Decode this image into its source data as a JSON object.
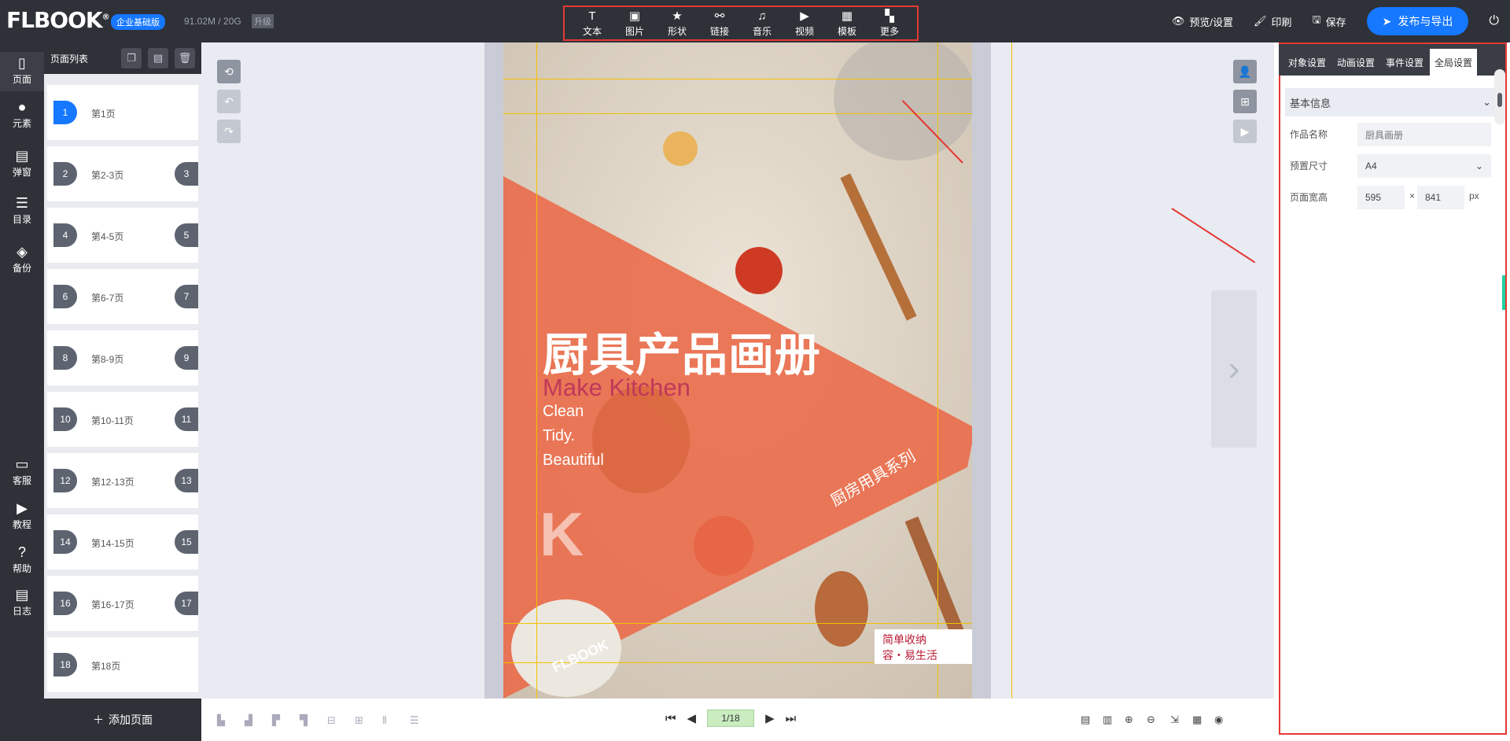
{
  "header": {
    "logo": "FLBOOK",
    "logo_mark": "®",
    "edition": "企业基础版",
    "storage": "91.02M / 20G",
    "upgrade": "升级"
  },
  "toolbar": [
    {
      "icon": "text-icon",
      "glyph": "T",
      "label": "文本"
    },
    {
      "icon": "image-icon",
      "glyph": "▣",
      "label": "图片"
    },
    {
      "icon": "star-icon",
      "glyph": "★",
      "label": "形状"
    },
    {
      "icon": "link-icon",
      "glyph": "⚯",
      "label": "链接"
    },
    {
      "icon": "music-icon",
      "glyph": "♫",
      "label": "音乐"
    },
    {
      "icon": "video-icon",
      "glyph": "▶",
      "label": "视频"
    },
    {
      "icon": "template-icon",
      "glyph": "▦",
      "label": "模板"
    },
    {
      "icon": "more-icon",
      "glyph": "▚",
      "label": "更多"
    }
  ],
  "topright": {
    "preview": "预览/设置",
    "print": "印刷",
    "save": "保存",
    "publish": "发布与导出"
  },
  "leftnav": [
    {
      "icon": "page-icon",
      "glyph": "▯",
      "label": "页面"
    },
    {
      "icon": "elements-icon",
      "glyph": "●",
      "label": "元素"
    },
    {
      "icon": "popup-icon",
      "glyph": "▤",
      "label": "弹窗"
    },
    {
      "icon": "catalog-icon",
      "glyph": "☰",
      "label": "目录"
    },
    {
      "icon": "backup-icon",
      "glyph": "◈",
      "label": "备份"
    },
    {
      "icon": "support-icon",
      "glyph": "▭",
      "label": "客服"
    },
    {
      "icon": "tutorial-icon",
      "glyph": "▶",
      "label": "教程"
    },
    {
      "icon": "help-icon",
      "glyph": "?",
      "label": "帮助"
    },
    {
      "icon": "log-icon",
      "glyph": "▤",
      "label": "日志"
    }
  ],
  "pagepanel": {
    "title": "页面列表",
    "add": "添加页面",
    "pages": [
      {
        "num": "1",
        "label": "第1页",
        "right": ""
      },
      {
        "num": "2",
        "label": "第2-3页",
        "right": "3"
      },
      {
        "num": "4",
        "label": "第4-5页",
        "right": "5"
      },
      {
        "num": "6",
        "label": "第6-7页",
        "right": "7"
      },
      {
        "num": "8",
        "label": "第8-9页",
        "right": "9"
      },
      {
        "num": "10",
        "label": "第10-11页",
        "right": "11"
      },
      {
        "num": "12",
        "label": "第12-13页",
        "right": "13"
      },
      {
        "num": "14",
        "label": "第14-15页",
        "right": "15"
      },
      {
        "num": "16",
        "label": "第16-17页",
        "right": "17"
      },
      {
        "num": "18",
        "label": "第18页",
        "right": ""
      }
    ]
  },
  "canvas": {
    "title_cn": "厨具产品画册",
    "make": "Make Kitchen",
    "words": [
      "Clean",
      "Tidy.",
      "Beautiful"
    ],
    "letter": "K",
    "series": "厨房用具系列",
    "stamp": "FLBOOK",
    "note_l1": "简单收纳",
    "note_l2": "容・易生活"
  },
  "rightpanel": {
    "tabs": [
      "对象设置",
      "动画设置",
      "事件设置",
      "全局设置"
    ],
    "section": "基本信息",
    "name_label": "作品名称",
    "name_placeholder": "厨具画册",
    "size_label": "预置尺寸",
    "size_value": "A4",
    "dim_label": "页面宽高",
    "width": "595",
    "x": "×",
    "height": "841",
    "unit": "px"
  },
  "pager": {
    "current": "1/18"
  }
}
